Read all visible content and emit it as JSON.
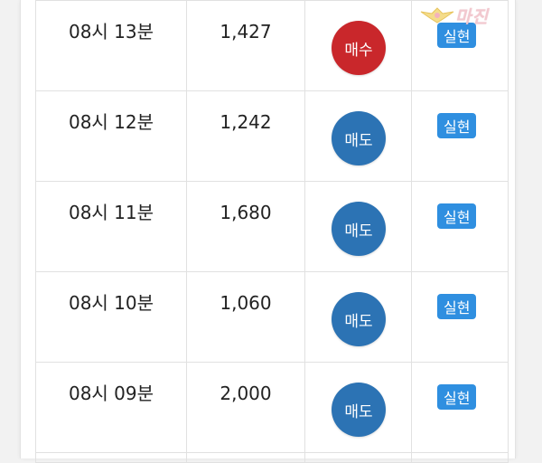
{
  "rows": [
    {
      "time": "08시 13분",
      "price": "1,427",
      "side": "매수",
      "side_type": "buy",
      "status": "실현"
    },
    {
      "time": "08시 12분",
      "price": "1,242",
      "side": "매도",
      "side_type": "sell",
      "status": "실현"
    },
    {
      "time": "08시 11분",
      "price": "1,680",
      "side": "매도",
      "side_type": "sell",
      "status": "실현"
    },
    {
      "time": "08시 10분",
      "price": "1,060",
      "side": "매도",
      "side_type": "sell",
      "status": "실현"
    },
    {
      "time": "08시 09분",
      "price": "2,000",
      "side": "매도",
      "side_type": "sell",
      "status": "실현"
    }
  ],
  "watermark": {
    "text": "마진"
  },
  "colors": {
    "buy": "#c9272b",
    "sell": "#2c73b4",
    "status_badge": "#2f8fe0"
  }
}
